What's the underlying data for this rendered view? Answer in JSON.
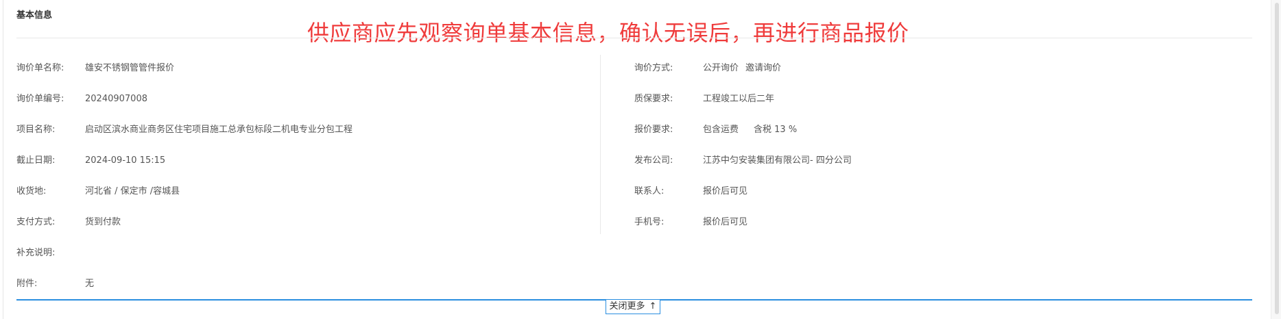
{
  "section_title": "基本信息",
  "notice": "供应商应先观察询单基本信息，确认无误后，再进行商品报价",
  "left_fields": [
    {
      "label": "询价单名称:",
      "value": "雄安不锈钢管管件报价"
    },
    {
      "label": "询价单编号:",
      "value": "20240907008"
    },
    {
      "label": "项目名称:",
      "value": "启动区滨水商业商务区住宅项目施工总承包标段二机电专业分包工程"
    },
    {
      "label": "截止日期:",
      "value": "2024-09-10 15:15"
    },
    {
      "label": "收货地:",
      "value": "河北省 / 保定市 /容城县"
    },
    {
      "label": "支付方式:",
      "value": "货到付款"
    },
    {
      "label": "补充说明:",
      "value": ""
    },
    {
      "label": "附件:",
      "value": "无"
    }
  ],
  "right_fields": [
    {
      "label": "询价方式:",
      "value_a": "公开询价",
      "value_b": "邀请询价"
    },
    {
      "label": "质保要求:",
      "value_a": "工程竣工以后二年",
      "value_b": ""
    },
    {
      "label": "报价要求:",
      "value_a": "包含运费",
      "value_b": "含税 13 %"
    },
    {
      "label": "发布公司:",
      "value_a": "江苏中匀安装集团有限公司- 四分公司",
      "value_b": ""
    },
    {
      "label": "联系人:",
      "value_a": "报价后可见",
      "value_b": ""
    },
    {
      "label": "手机号:",
      "value_a": "报价后可见",
      "value_b": ""
    }
  ],
  "toggle": {
    "label": "关闭更多",
    "icon": "arrow-up-icon",
    "glyph": "↑"
  },
  "colors": {
    "notice": "#ef3b3b",
    "accent": "#2a8ee0"
  }
}
